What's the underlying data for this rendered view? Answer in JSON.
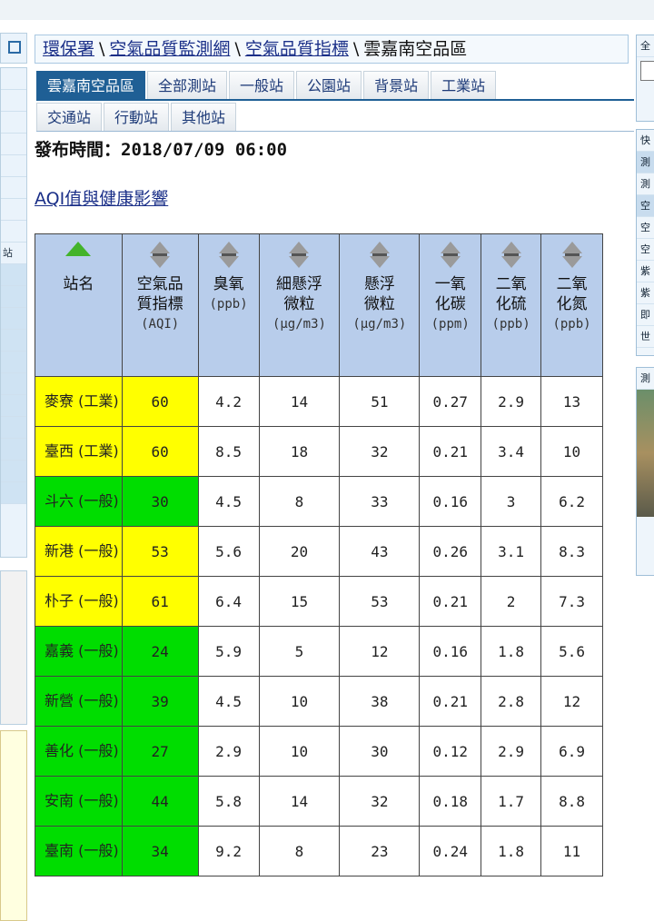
{
  "breadcrumb": {
    "items": [
      "環保署",
      "空氣品質監測網",
      "空氣品質指標"
    ],
    "current": "雲嘉南空品區",
    "separator": "\\"
  },
  "tabs_row1": [
    "雲嘉南空品區",
    "全部測站",
    "一般站",
    "公園站",
    "背景站",
    "工業站"
  ],
  "tabs_row2": [
    "交通站",
    "行動站",
    "其他站"
  ],
  "publish": {
    "label": "發布時間：",
    "time": "2018/07/09 06:00"
  },
  "aqi_link": "AQI值與健康影響",
  "left_rail": {
    "label": "站"
  },
  "right_rail": {
    "rows": [
      "全",
      "快",
      "測",
      "測",
      "空",
      "空",
      "空",
      "紫",
      "紫",
      "即",
      "世",
      "測"
    ]
  },
  "colors": {
    "good": "#00dd00",
    "moderate": "#ffff00",
    "header": "#b8cdeb",
    "brand": "#1f5f95"
  },
  "table": {
    "headers": [
      {
        "name": "站名",
        "unit": ""
      },
      {
        "name": "空氣品質指標",
        "unit": "(AQI)"
      },
      {
        "name": "臭氧",
        "unit": "(ppb)"
      },
      {
        "name": "細懸浮微粒",
        "unit": "(μg/m3)"
      },
      {
        "name": "懸浮微粒",
        "unit": "(μg/m3)"
      },
      {
        "name": "一氧化碳",
        "unit": "(ppm)"
      },
      {
        "name": "二氧化硫",
        "unit": "(ppb)"
      },
      {
        "name": "二氧化氮",
        "unit": "(ppb)"
      }
    ],
    "rows": [
      {
        "site": "麥寮 (工業)",
        "aqi": "60",
        "o3": "4.2",
        "pm25": "14",
        "pm10": "51",
        "co": "0.27",
        "so2": "2.9",
        "no2": "13",
        "level": "moderate"
      },
      {
        "site": "臺西 (工業)",
        "aqi": "60",
        "o3": "8.5",
        "pm25": "18",
        "pm10": "32",
        "co": "0.21",
        "so2": "3.4",
        "no2": "10",
        "level": "moderate"
      },
      {
        "site": "斗六 (一般)",
        "aqi": "30",
        "o3": "4.5",
        "pm25": "8",
        "pm10": "33",
        "co": "0.16",
        "so2": "3",
        "no2": "6.2",
        "level": "good"
      },
      {
        "site": "新港 (一般)",
        "aqi": "53",
        "o3": "5.6",
        "pm25": "20",
        "pm10": "43",
        "co": "0.26",
        "so2": "3.1",
        "no2": "8.3",
        "level": "moderate"
      },
      {
        "site": "朴子 (一般)",
        "aqi": "61",
        "o3": "6.4",
        "pm25": "15",
        "pm10": "53",
        "co": "0.21",
        "so2": "2",
        "no2": "7.3",
        "level": "moderate"
      },
      {
        "site": "嘉義 (一般)",
        "aqi": "24",
        "o3": "5.9",
        "pm25": "5",
        "pm10": "12",
        "co": "0.16",
        "so2": "1.8",
        "no2": "5.6",
        "level": "good"
      },
      {
        "site": "新營 (一般)",
        "aqi": "39",
        "o3": "4.5",
        "pm25": "10",
        "pm10": "38",
        "co": "0.21",
        "so2": "2.8",
        "no2": "12",
        "level": "good"
      },
      {
        "site": "善化 (一般)",
        "aqi": "27",
        "o3": "2.9",
        "pm25": "10",
        "pm10": "30",
        "co": "0.12",
        "so2": "2.9",
        "no2": "6.9",
        "level": "good"
      },
      {
        "site": "安南 (一般)",
        "aqi": "44",
        "o3": "5.8",
        "pm25": "14",
        "pm10": "32",
        "co": "0.18",
        "so2": "1.7",
        "no2": "8.8",
        "level": "good"
      },
      {
        "site": "臺南 (一般)",
        "aqi": "34",
        "o3": "9.2",
        "pm25": "8",
        "pm10": "23",
        "co": "0.24",
        "so2": "1.8",
        "no2": "11",
        "level": "good"
      }
    ]
  }
}
